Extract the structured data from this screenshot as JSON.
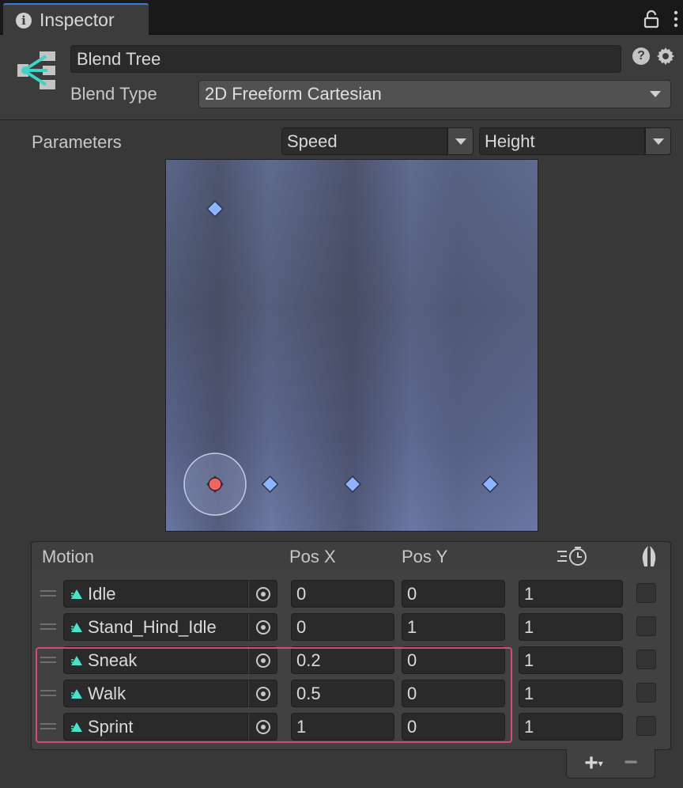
{
  "window": {
    "tab_label": "Inspector",
    "tab_icon": "info-icon",
    "lock_icon": "lock-icon",
    "menu_icon": "kebab-icon"
  },
  "header": {
    "name": "Blend Tree",
    "blend_type_label": "Blend Type",
    "blend_type_value": "2D Freeform Cartesian",
    "help_icon": "help-icon",
    "settings_icon": "gear-icon",
    "help_glyph": "?"
  },
  "parameters": {
    "label": "Parameters",
    "x_param": "Speed",
    "y_param": "Height"
  },
  "graph": {
    "x_range": [
      0,
      1
    ],
    "y_range": [
      0,
      1
    ],
    "current": {
      "x": 0,
      "y": 0
    },
    "points": [
      {
        "motion": "Idle",
        "x": 0,
        "y": 0
      },
      {
        "motion": "Stand_Hind_Idle",
        "x": 0,
        "y": 1
      },
      {
        "motion": "Sneak",
        "x": 0.2,
        "y": 0
      },
      {
        "motion": "Walk",
        "x": 0.5,
        "y": 0
      },
      {
        "motion": "Sprint",
        "x": 1,
        "y": 0
      }
    ],
    "colors": {
      "point": "#8fb4ff",
      "current": "#f06464"
    }
  },
  "motion_list": {
    "columns": {
      "motion": "Motion",
      "pos_x": "Pos X",
      "pos_y": "Pos Y",
      "speed_icon": "time-scale-icon",
      "mirror_icon": "mirror-icon"
    },
    "rows": [
      {
        "motion": "Idle",
        "pos_x": "0",
        "pos_y": "0",
        "speed": "1"
      },
      {
        "motion": "Stand_Hind_Idle",
        "pos_x": "0",
        "pos_y": "1",
        "speed": "1"
      },
      {
        "motion": "Sneak",
        "pos_x": "0.2",
        "pos_y": "0",
        "speed": "1"
      },
      {
        "motion": "Walk",
        "pos_x": "0.5",
        "pos_y": "0",
        "speed": "1"
      },
      {
        "motion": "Sprint",
        "pos_x": "1",
        "pos_y": "0",
        "speed": "1"
      }
    ],
    "highlight_color": "#d34a73"
  },
  "footer": {
    "add_label": "+",
    "remove_label": "−"
  }
}
